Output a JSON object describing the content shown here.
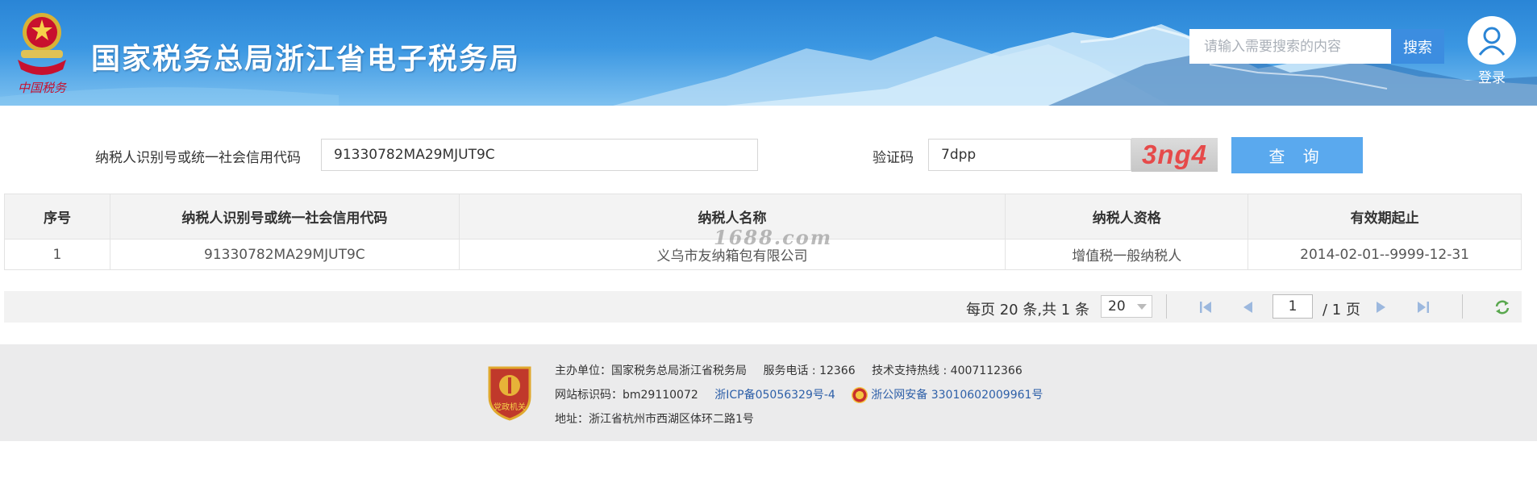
{
  "header": {
    "site_title": "国家税务总局浙江省电子税务局",
    "emblem_caption": "中国税务",
    "search_placeholder": "请输入需要搜索的内容",
    "search_button": "搜索",
    "login_label": "登录"
  },
  "query": {
    "taxpayer_id_label": "纳税人识别号或统一社会信用代码",
    "taxpayer_id_value": "91330782MA29MJUT9C",
    "captcha_label": "验证码",
    "captcha_value": "7dpp",
    "captcha_image_text": "3ng4",
    "query_button": "查 询"
  },
  "table": {
    "headers": [
      "序号",
      "纳税人识别号或统一社会信用代码",
      "纳税人名称",
      "纳税人资格",
      "有效期起止"
    ],
    "rows": [
      [
        "1",
        "91330782MA29MJUT9C",
        "义乌市友纳箱包有限公司",
        "增值税一般纳税人",
        "2014-02-01--9999-12-31"
      ]
    ],
    "watermark": "1688.com"
  },
  "pagination": {
    "summary": "每页 20 条,共 1 条",
    "page_size": "20",
    "current_page": "1",
    "total_pages": "/ 1 页"
  },
  "footer": {
    "badge_text": "党政机关",
    "sponsor": "主办单位：国家税务总局浙江省税务局",
    "service_phone": "服务电话 : 12366",
    "support_hotline": "技术支持热线 : 4007112366",
    "site_id": "网站标识码：bm29110072",
    "icp": "浙ICP备05056329号-4",
    "police_record": "浙公网安备 33010602009961号",
    "address": "地址：浙江省杭州市西湖区体环二路1号"
  },
  "colors": {
    "header_blue": "#2a85d6",
    "button_blue": "#5aa9ee",
    "captcha_red": "#e64a4a",
    "footer_link": "#2d5fa8"
  }
}
